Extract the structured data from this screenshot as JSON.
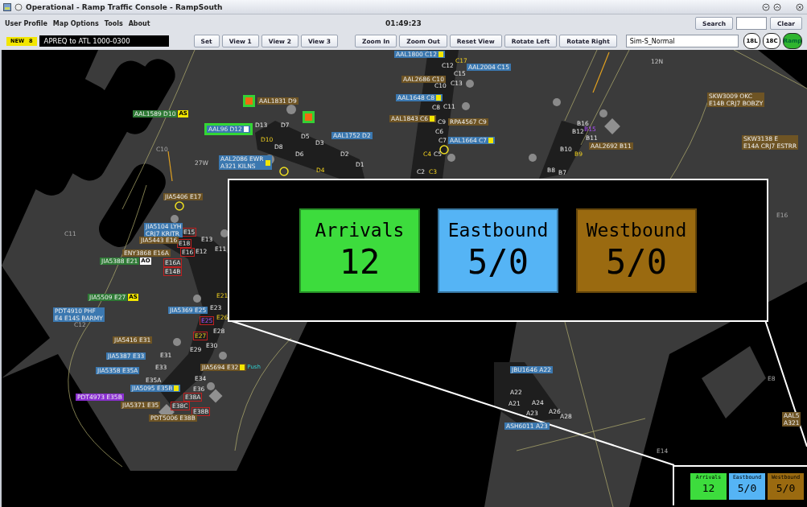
{
  "window": {
    "title": "Operational - Ramp Traffic Console - RampSouth"
  },
  "menu": [
    "User Profile",
    "Map Options",
    "Tools",
    "About"
  ],
  "clock": "01:49:23",
  "search": {
    "button": "Search",
    "clear": "Clear"
  },
  "toolbar": {
    "alert": {
      "label": "NEW",
      "count": "8"
    },
    "message": "APREQ to ATL 1000-0300",
    "buttons": [
      "Set",
      "View 1",
      "View 2",
      "View 3",
      "Zoom In",
      "Zoom Out",
      "Reset View",
      "Rotate Left",
      "Rotate Right"
    ],
    "scenario": "Sim-S_Normal",
    "runways": [
      {
        "label": "18L",
        "active": false
      },
      {
        "label": "18C",
        "active": false
      },
      {
        "label": "Ramp",
        "active": true
      }
    ]
  },
  "map": {
    "flights": [
      {
        "lines": [
          "AAL1589 D10"
        ],
        "color": "#2e7a35",
        "selected": false,
        "flagged": false,
        "badge": {
          "text": "AS",
          "color": "#f2e600"
        }
      },
      {
        "lines": [
          "AAL1831 D9"
        ],
        "color": "#6e5424",
        "selected": false,
        "flagged": false
      },
      {
        "lines": [
          "AAL96 D12"
        ],
        "color": "#3b78b0",
        "selected": true,
        "flagged": true
      },
      {
        "lines": [
          "AAL2086 EWR",
          "A321 KILNS"
        ],
        "color": "#3b78b0",
        "selected": false,
        "flagged": true
      },
      {
        "lines": [
          "AAL1752 D2"
        ],
        "color": "#3b78b0",
        "selected": false,
        "flagged": false
      },
      {
        "lines": [
          "JIA5406 E17"
        ],
        "color": "#6e5424",
        "selected": false,
        "flagged": false
      },
      {
        "lines": [
          "JIA5104 LYH",
          "CRJ7 KRITR"
        ],
        "color": "#3b78b0",
        "selected": false,
        "flagged": false
      },
      {
        "lines": [
          "JIA5443 E16"
        ],
        "color": "#6e5424",
        "selected": false,
        "flagged": false
      },
      {
        "lines": [
          "ENY3868 E16A"
        ],
        "color": "#6e5424",
        "selected": false,
        "flagged": false
      },
      {
        "lines": [
          "JIA5388 E21"
        ],
        "color": "#2e7a35",
        "selected": false,
        "flagged": false,
        "badge": {
          "text": "AO",
          "color": "#ffffff"
        }
      },
      {
        "lines": [
          "JIA5509 E27"
        ],
        "color": "#2e7a35",
        "selected": false,
        "flagged": false,
        "badge": {
          "text": "AS",
          "color": "#f2e600"
        }
      },
      {
        "lines": [
          "PDT4910 PHF",
          "E4 E14S BARMY"
        ],
        "color": "#3b78b0",
        "selected": false,
        "flagged": false
      },
      {
        "lines": [
          "JIA5369 E25"
        ],
        "color": "#3b78b0",
        "selected": false,
        "flagged": false
      },
      {
        "lines": [
          "JIA5416 E31"
        ],
        "color": "#6e5424",
        "selected": false,
        "flagged": false
      },
      {
        "lines": [
          "JIA5387 E33"
        ],
        "color": "#3b78b0",
        "selected": false,
        "flagged": false
      },
      {
        "lines": [
          "JIA5358 E35A"
        ],
        "color": "#3b78b0",
        "selected": false,
        "flagged": false
      },
      {
        "lines": [
          "JIA5694 E32"
        ],
        "color": "#6e5424",
        "selected": false,
        "flagged": true,
        "note": "Push"
      },
      {
        "lines": [
          "PDT4973 E35B"
        ],
        "color": "#8a2fd0",
        "selected": false,
        "flagged": false
      },
      {
        "lines": [
          "JIA5095 E35B"
        ],
        "color": "#3b78b0",
        "selected": false,
        "flagged": true
      },
      {
        "lines": [
          "JIA5371 E35"
        ],
        "color": "#6e5424",
        "selected": false,
        "flagged": false
      },
      {
        "lines": [
          "PDT5006 E38B"
        ],
        "color": "#6e5424",
        "selected": false,
        "flagged": false
      },
      {
        "lines": [
          "AAL1800 C12"
        ],
        "color": "#3b78b0",
        "selected": false,
        "flagged": true
      },
      {
        "lines": [
          "AAL2004 C15"
        ],
        "color": "#3b78b0",
        "selected": false,
        "flagged": false
      },
      {
        "lines": [
          "AAL2686 C10"
        ],
        "color": "#6e5424",
        "selected": false,
        "flagged": false
      },
      {
        "lines": [
          "AAL1648 C8"
        ],
        "color": "#3b78b0",
        "selected": false,
        "flagged": true
      },
      {
        "lines": [
          "AAL1843 C6"
        ],
        "color": "#6e5424",
        "selected": false,
        "flagged": true
      },
      {
        "lines": [
          "RPA4567 C9"
        ],
        "color": "#6e5424",
        "selected": false,
        "flagged": false
      },
      {
        "lines": [
          "AAL1664 C7"
        ],
        "color": "#3b78b0",
        "selected": false,
        "flagged": true
      },
      {
        "lines": [
          "AAL2692 B11"
        ],
        "color": "#6e5424",
        "selected": false,
        "flagged": false
      },
      {
        "lines": [
          "SKW3009 OKC",
          "E14B CRJ7 BOBZY"
        ],
        "color": "#6e5424",
        "selected": false,
        "flagged": false
      },
      {
        "lines": [
          "SKW3138 E",
          "E14A CRJ7 ESTRR"
        ],
        "color": "#6e5424",
        "selected": false,
        "flagged": false
      },
      {
        "lines": [
          "JBU1646 A22"
        ],
        "color": "#3b78b0",
        "selected": false,
        "flagged": false
      },
      {
        "lines": [
          "ASH6011 A23"
        ],
        "color": "#3b78b0",
        "selected": false,
        "flagged": false
      },
      {
        "lines": [
          "AAL5",
          "A321"
        ],
        "color": "#6e5424",
        "selected": false,
        "flagged": false
      }
    ],
    "gates": [
      {
        "text": "D13",
        "kind": "gate",
        "boxed": false
      },
      {
        "text": "D10",
        "kind": "assigned",
        "boxed": false
      },
      {
        "text": "D7",
        "kind": "gate",
        "boxed": false
      },
      {
        "text": "D5",
        "kind": "gate",
        "boxed": false
      },
      {
        "text": "D3",
        "kind": "gate",
        "boxed": false
      },
      {
        "text": "D8",
        "kind": "gate",
        "boxed": false
      },
      {
        "text": "D6",
        "kind": "gate",
        "boxed": false
      },
      {
        "text": "D2",
        "kind": "gate",
        "boxed": false
      },
      {
        "text": "D1",
        "kind": "gate",
        "boxed": false
      },
      {
        "text": "D4",
        "kind": "assigned",
        "boxed": false
      },
      {
        "text": "C10",
        "kind": "taxiway",
        "boxed": false
      },
      {
        "text": "C11",
        "kind": "taxiway",
        "boxed": false
      },
      {
        "text": "C12",
        "kind": "taxiway",
        "boxed": false
      },
      {
        "text": "E13",
        "kind": "gate",
        "boxed": false
      },
      {
        "text": "E15",
        "kind": "gate",
        "boxed": true
      },
      {
        "text": "E18",
        "kind": "gate",
        "boxed": true
      },
      {
        "text": "E12",
        "kind": "gate",
        "boxed": false
      },
      {
        "text": "E11",
        "kind": "gate",
        "boxed": false
      },
      {
        "text": "E16",
        "kind": "gate",
        "boxed": true
      },
      {
        "text": "E16A",
        "kind": "gate",
        "boxed": true
      },
      {
        "text": "E14B",
        "kind": "gate",
        "boxed": true
      },
      {
        "text": "E21",
        "kind": "assigned",
        "boxed": false
      },
      {
        "text": "E23",
        "kind": "gate",
        "boxed": false
      },
      {
        "text": "E26",
        "kind": "assigned",
        "boxed": false
      },
      {
        "text": "E28",
        "kind": "gate",
        "boxed": false
      },
      {
        "text": "E27",
        "kind": "assigned",
        "boxed": true
      },
      {
        "text": "E25",
        "kind": "alert",
        "boxed": true
      },
      {
        "text": "E29",
        "kind": "gate",
        "boxed": false
      },
      {
        "text": "E30",
        "kind": "gate",
        "boxed": false
      },
      {
        "text": "E31",
        "kind": "gate",
        "boxed": false
      },
      {
        "text": "E33",
        "kind": "gate",
        "boxed": false
      },
      {
        "text": "E35A",
        "kind": "gate",
        "boxed": false
      },
      {
        "text": "E34",
        "kind": "gate",
        "boxed": false
      },
      {
        "text": "E36",
        "kind": "gate",
        "boxed": false
      },
      {
        "text": "E38A",
        "kind": "gate",
        "boxed": true
      },
      {
        "text": "E38C",
        "kind": "gate",
        "boxed": true
      },
      {
        "text": "E38B",
        "kind": "gate",
        "boxed": true
      },
      {
        "text": "C17",
        "kind": "assigned",
        "boxed": false
      },
      {
        "text": "C12",
        "kind": "gate",
        "boxed": false
      },
      {
        "text": "C15",
        "kind": "gate",
        "boxed": false
      },
      {
        "text": "C13",
        "kind": "gate",
        "boxed": false
      },
      {
        "text": "C10",
        "kind": "gate",
        "boxed": false
      },
      {
        "text": "C8",
        "kind": "gate",
        "boxed": false
      },
      {
        "text": "C11",
        "kind": "gate",
        "boxed": false
      },
      {
        "text": "C9",
        "kind": "gate",
        "boxed": false
      },
      {
        "text": "C6",
        "kind": "gate",
        "boxed": false
      },
      {
        "text": "C7",
        "kind": "gate",
        "boxed": false
      },
      {
        "text": "C4",
        "kind": "assigned",
        "boxed": false
      },
      {
        "text": "C5",
        "kind": "gate",
        "boxed": false
      },
      {
        "text": "C2",
        "kind": "gate",
        "boxed": false
      },
      {
        "text": "C3",
        "kind": "assigned",
        "boxed": false
      },
      {
        "text": "B16",
        "kind": "gate",
        "boxed": false
      },
      {
        "text": "B12",
        "kind": "gate",
        "boxed": false
      },
      {
        "text": "B15",
        "kind": "alert",
        "boxed": false
      },
      {
        "text": "B11",
        "kind": "gate",
        "boxed": false
      },
      {
        "text": "B10",
        "kind": "gate",
        "boxed": false
      },
      {
        "text": "B9",
        "kind": "assigned",
        "boxed": false
      },
      {
        "text": "B8",
        "kind": "gate",
        "boxed": false
      },
      {
        "text": "B7",
        "kind": "gate",
        "boxed": false
      },
      {
        "text": "A22",
        "kind": "gate",
        "boxed": false
      },
      {
        "text": "A21",
        "kind": "gate",
        "boxed": false
      },
      {
        "text": "A24",
        "kind": "gate",
        "boxed": false
      },
      {
        "text": "A23",
        "kind": "gate",
        "boxed": false
      },
      {
        "text": "A26",
        "kind": "gate",
        "boxed": false
      },
      {
        "text": "A28",
        "kind": "gate",
        "boxed": false
      },
      {
        "text": "E16",
        "kind": "taxiway",
        "boxed": false
      },
      {
        "text": "E8",
        "kind": "taxiway",
        "boxed": false
      },
      {
        "text": "E14",
        "kind": "taxiway",
        "boxed": false
      },
      {
        "text": "27W",
        "kind": "marking",
        "boxed": false
      },
      {
        "text": "12N",
        "kind": "marking",
        "boxed": false
      }
    ]
  },
  "counters": [
    {
      "label": "Arrivals",
      "value": "12",
      "color": "#3ddc3d"
    },
    {
      "label": "Eastbound",
      "value": "5/0",
      "color": "#55b4f5"
    },
    {
      "label": "Westbound",
      "value": "5/0",
      "color": "#9a6a10"
    }
  ],
  "mini_counters": [
    {
      "label": "Arrivals",
      "value": "12",
      "color": "#3ddc3d"
    },
    {
      "label": "Eastbound",
      "value": "5/0",
      "color": "#55b4f5"
    },
    {
      "label": "Westbound",
      "value": "5/0",
      "color": "#9a6a10"
    }
  ]
}
